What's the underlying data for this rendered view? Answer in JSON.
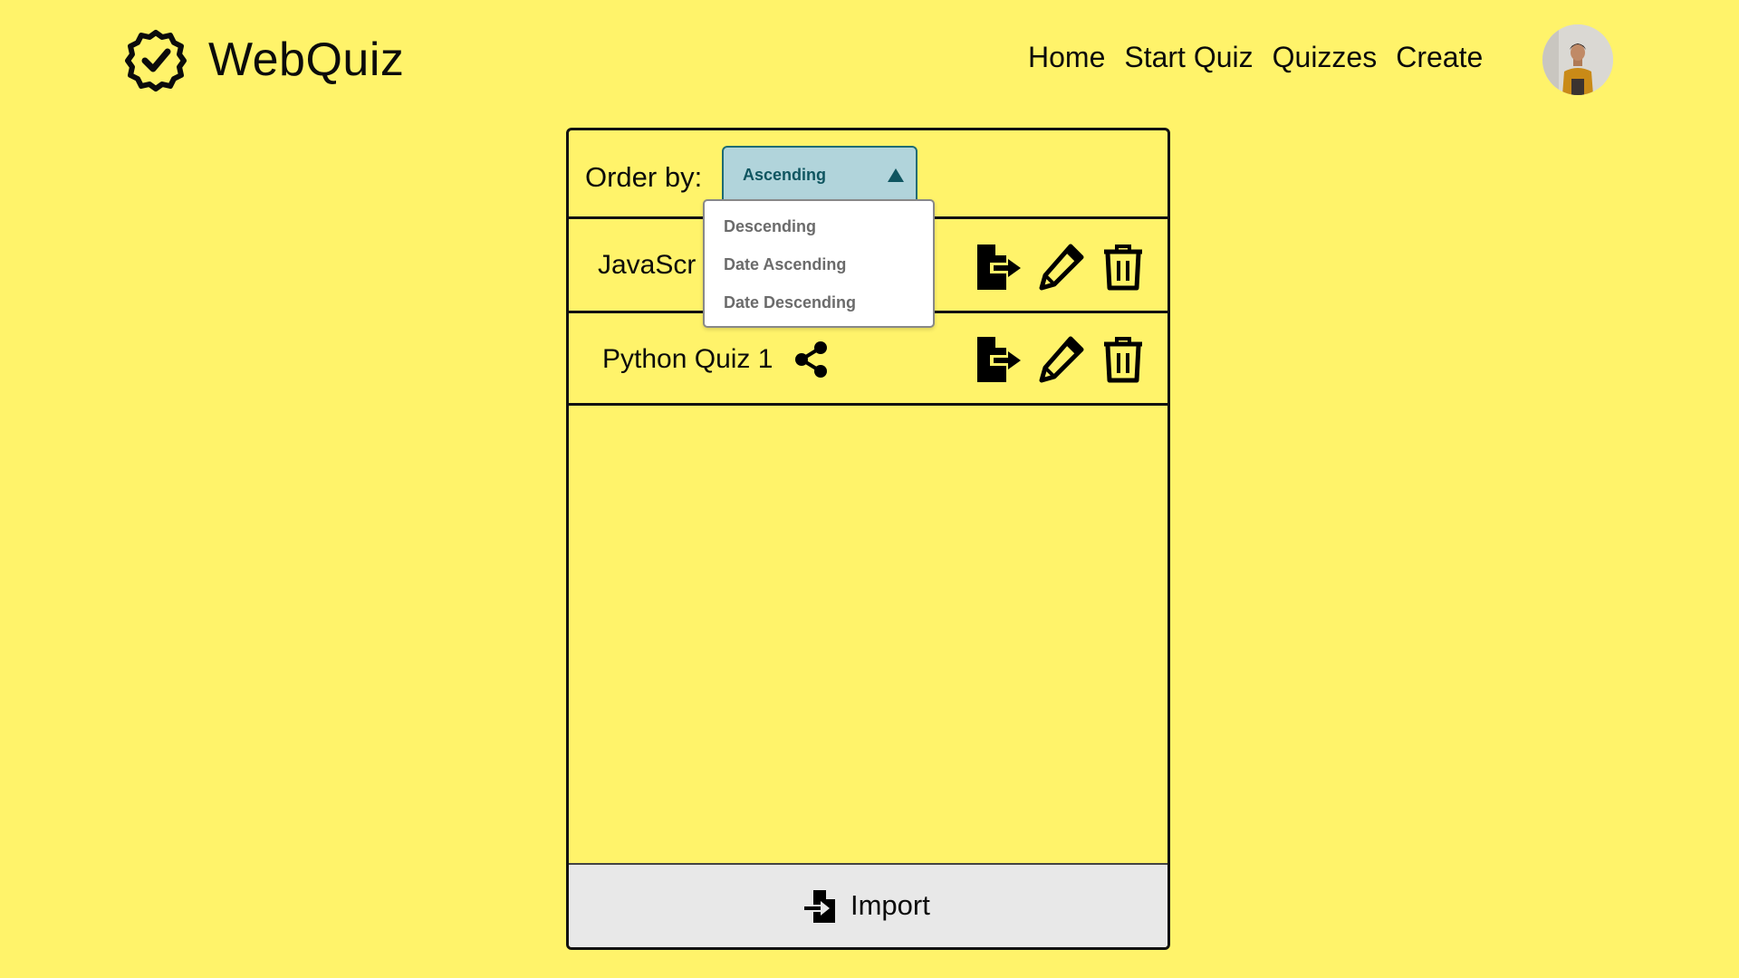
{
  "header": {
    "brand": "WebQuiz",
    "nav": [
      "Home",
      "Start Quiz",
      "Quizzes",
      "Create"
    ]
  },
  "toolbar": {
    "order_label": "Order by:",
    "selected": "Ascending"
  },
  "dropdown": {
    "options": [
      "Descending",
      "Date Ascending",
      "Date Descending"
    ]
  },
  "quizzes": [
    {
      "title": "JavaScr"
    },
    {
      "title": "Python Quiz 1"
    }
  ],
  "import": {
    "label": "Import"
  },
  "colors": {
    "background": "#FFF36A",
    "select_bg": "#B1D4DB",
    "select_text": "#0f5560",
    "import_bg": "#E8E8E8"
  }
}
